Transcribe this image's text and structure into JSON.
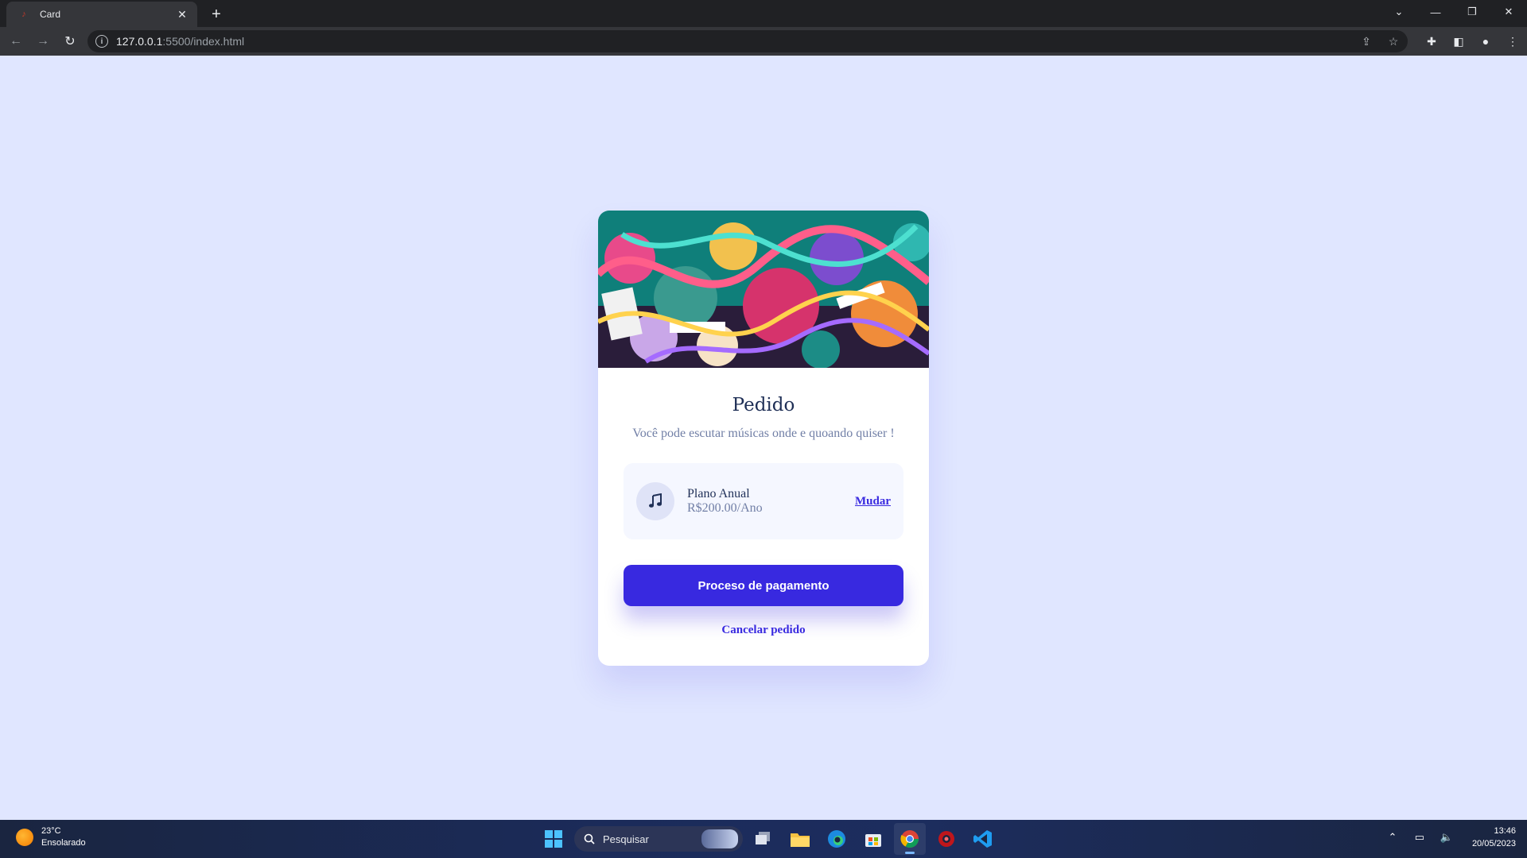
{
  "browser": {
    "tab_title": "Card",
    "url_host": "127.0.0.1",
    "url_path": ":5500/index.html"
  },
  "card": {
    "title": "Pedido",
    "subtitle": "Você pode escutar músicas onde e quoando quiser !",
    "plan": {
      "name": "Plano Anual",
      "price": "R$200.00/Ano",
      "change_label": "Mudar",
      "icon": "music-note-icon"
    },
    "pay_button": "Proceso de pagamento",
    "cancel_link": "Cancelar pedido",
    "hero_image": "music-doodle-illustration"
  },
  "colors": {
    "page_bg": "#e0e6ff",
    "primary": "#3829e0",
    "title": "#1f2f56",
    "muted": "#717fa6",
    "plan_bg": "#f5f7ff"
  },
  "taskbar": {
    "weather_temp": "23°C",
    "weather_desc": "Ensolarado",
    "search_placeholder": "Pesquisar",
    "time": "13:46",
    "date": "20/05/2023",
    "apps": [
      "task-view-icon",
      "file-explorer-icon",
      "edge-icon",
      "store-icon",
      "chrome-icon",
      "app-red-icon",
      "vscode-icon"
    ]
  }
}
